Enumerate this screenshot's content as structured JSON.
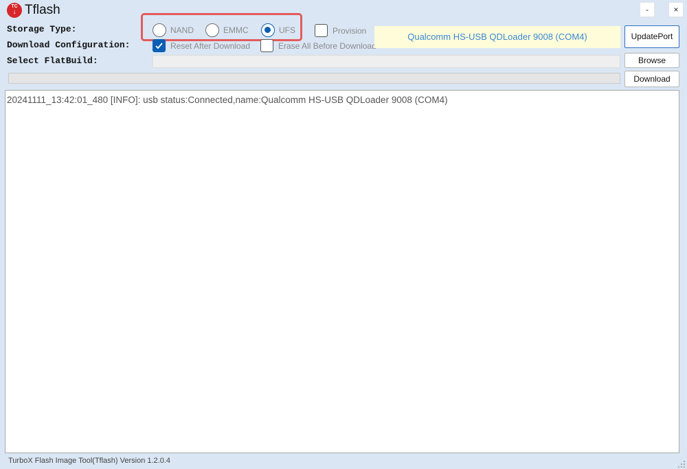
{
  "app": {
    "title": "Tflash",
    "logo_text": "TC",
    "logo_arrow": "↓",
    "minimize": "-",
    "close": "×"
  },
  "labels": {
    "storage_type": "Storage Type:",
    "download_configuration": "Download Configuration:",
    "select_flatbuild": "Select FlatBuild:"
  },
  "storage": {
    "options": [
      "NAND",
      "EMMC",
      "UFS"
    ],
    "selected": "UFS"
  },
  "options": {
    "provision": {
      "label": "Provision",
      "checked": false
    },
    "reset_after_download": {
      "label": "Reset After Download",
      "checked": true
    },
    "erase_all_before_download": {
      "label": "Erase All Before Download",
      "checked": false
    }
  },
  "port": {
    "display": "Qualcomm HS-USB QDLoader 9008 (COM4)"
  },
  "buttons": {
    "update_port": "UpdatePort",
    "browse": "Browse",
    "download": "Download"
  },
  "flatbuild": {
    "path": ""
  },
  "progress": {
    "value": 0
  },
  "log": [
    "20241111_13:42:01_480 [INFO]: usb status:Connected,name:Qualcomm HS-USB QDLoader 9008 (COM4)"
  ],
  "status_bar": {
    "text": "TurboX Flash Image Tool(Tflash) Version 1.2.0.4"
  },
  "colors": {
    "accent": "#0a5fb5",
    "highlight_border": "#e35b5b",
    "port_background": "#fffdd9",
    "port_text": "#3a87d6",
    "window_background": "#dae6f4"
  }
}
